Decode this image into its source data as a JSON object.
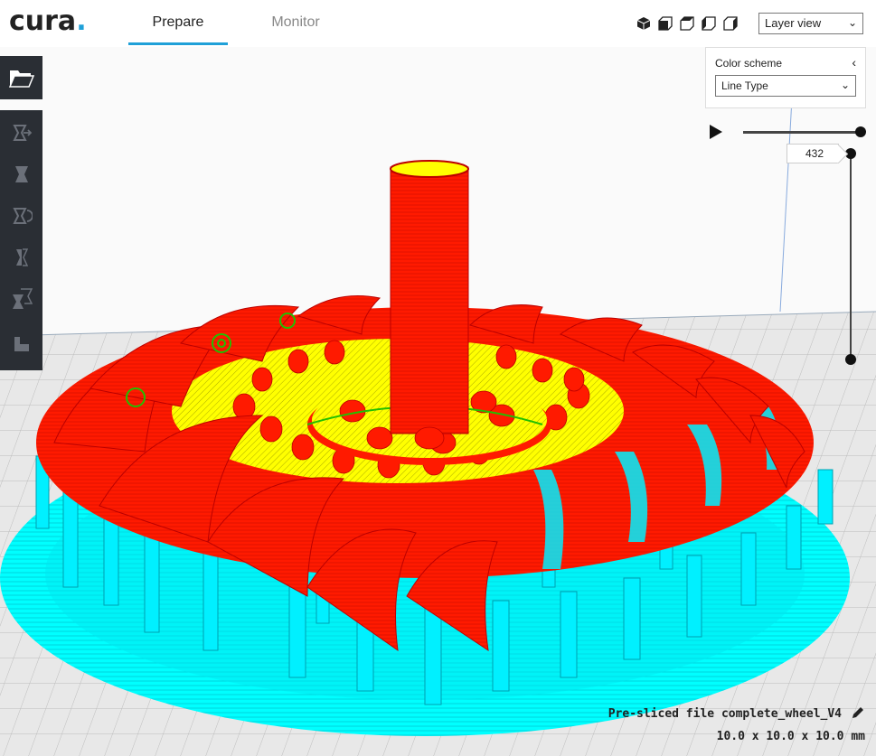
{
  "app": {
    "logo_text": "cura",
    "logo_dot": ".",
    "brand_color": "#1fa0d8"
  },
  "tabs": [
    {
      "label": "Prepare",
      "active": true
    },
    {
      "label": "Monitor",
      "active": false
    }
  ],
  "view": {
    "icons": [
      "3d-view-icon",
      "front-view-icon",
      "top-view-icon",
      "left-view-icon",
      "right-view-icon"
    ],
    "mode_selected": "Layer view"
  },
  "color_scheme": {
    "title": "Color scheme",
    "selected": "Line Type"
  },
  "layer_slider": {
    "current_layer": "432",
    "play_icon": "play-icon"
  },
  "toolbar": {
    "open_icon": "folder-open-icon",
    "tools": [
      "move-icon",
      "scale-icon",
      "rotate-icon",
      "mirror-icon",
      "per-model-settings-icon",
      "support-blocker-icon"
    ]
  },
  "file": {
    "name_label": "Pre-sliced file complete_wheel_V4",
    "dimensions": "10.0 x 10.0 x 10.0 mm",
    "edit_icon": "pencil-icon"
  },
  "colors": {
    "wall": "#ff1a00",
    "infill": "#ffff00",
    "support": "#00ffff",
    "inner": "#00c000",
    "toolbar_bg": "#2a2e34"
  }
}
